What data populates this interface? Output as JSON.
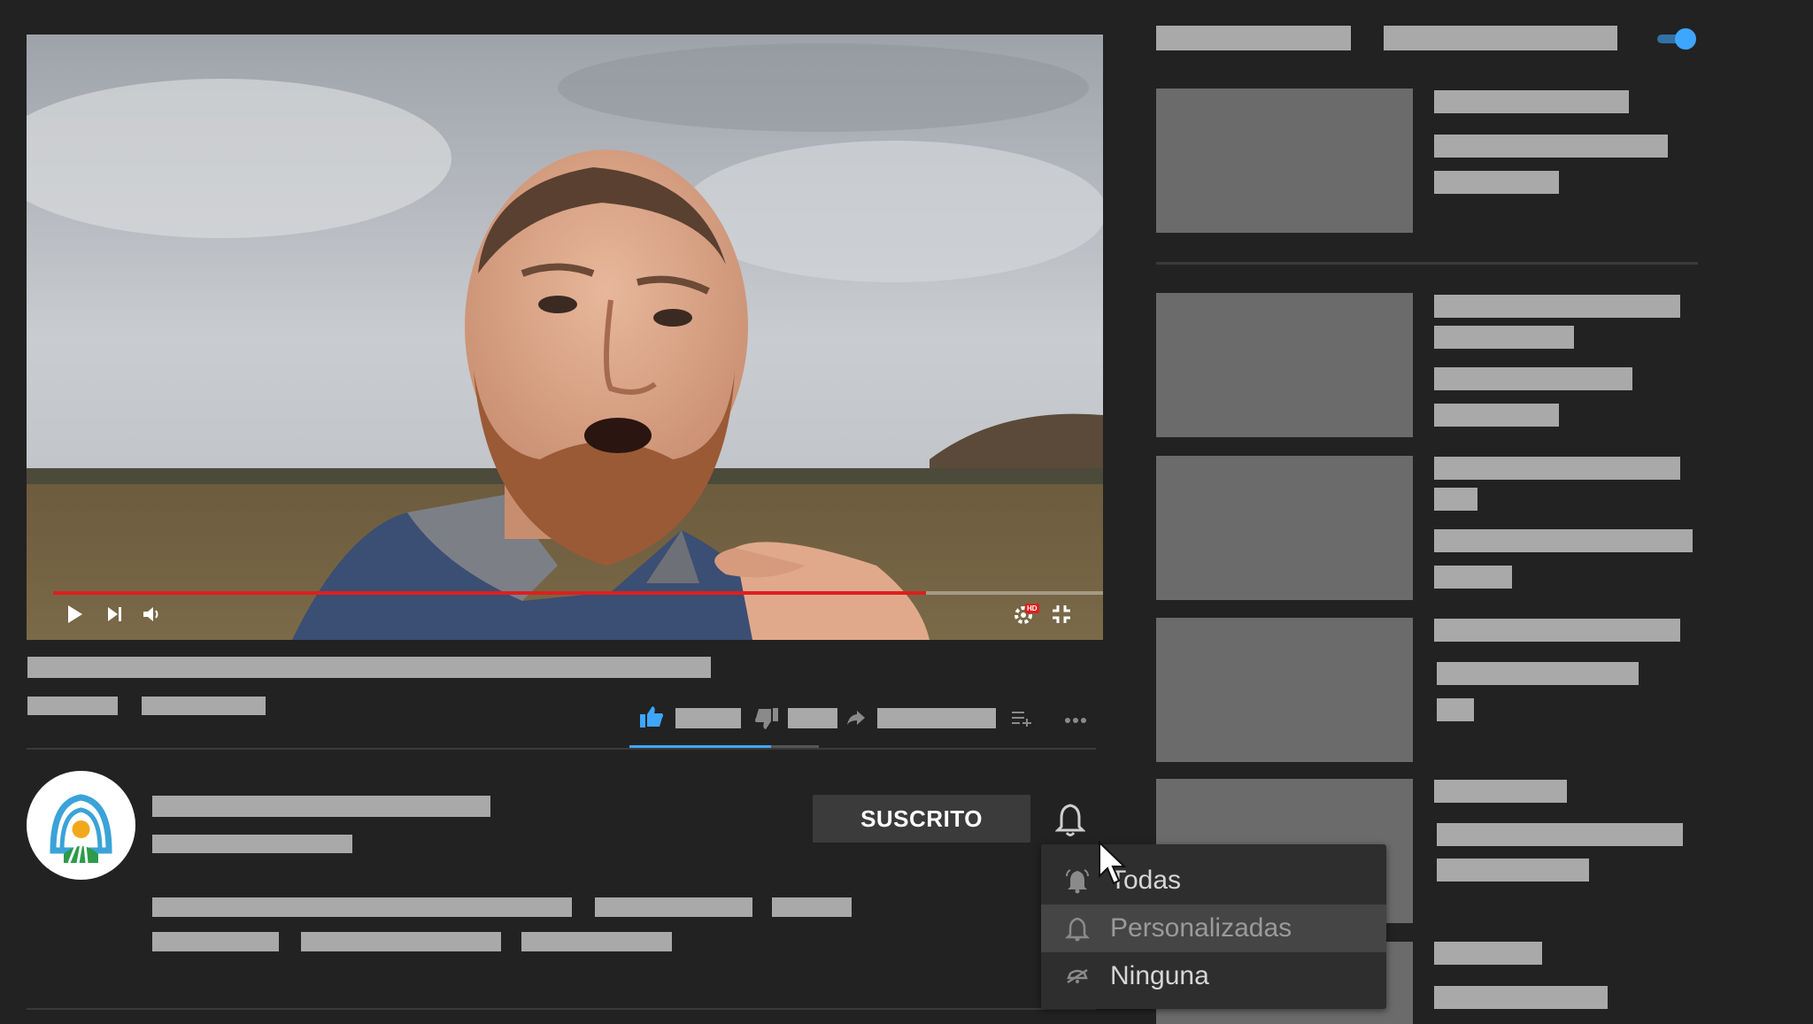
{
  "player": {
    "progress_fraction": 0.83,
    "hd_badge": "HD",
    "icons": [
      "play-icon",
      "next-icon",
      "volume-icon",
      "settings-icon",
      "exit-fullscreen-icon"
    ]
  },
  "actions": {
    "icons": [
      "like-icon",
      "dislike-icon",
      "share-icon",
      "add-to-playlist-icon",
      "more-icon"
    ],
    "like_accent": "#3ea6ff"
  },
  "channel": {
    "subscribe_label": "SUSCRITO",
    "bell_icon": "bell-icon"
  },
  "notifications_menu": {
    "items": [
      {
        "label": "Todas",
        "icon": "bell-ringing-icon"
      },
      {
        "label": "Personalizadas",
        "icon": "bell-icon",
        "highlighted": true
      },
      {
        "label": "Ninguna",
        "icon": "bell-off-icon"
      }
    ]
  },
  "sidebar": {
    "autoplay_on": true,
    "autoplay_color": "#3ea6ff"
  },
  "colors": {
    "background": "#222222",
    "placeholder_bar": "#a9a9a9",
    "placeholder_thumb": "#6b6b6b",
    "progress": "#e01e1e"
  }
}
